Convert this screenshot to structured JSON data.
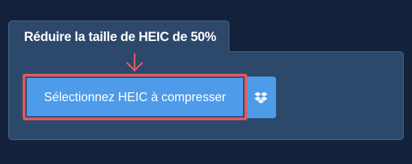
{
  "panel": {
    "title": "Réduire la taille de HEIC de 50%"
  },
  "upload": {
    "button_label": "Sélectionnez HEIC à compresser",
    "dropbox_icon": "dropbox-icon"
  },
  "annotation": {
    "highlight_color": "#e05a5f",
    "arrow_icon": "arrow-down-icon"
  },
  "colors": {
    "background": "#13223a",
    "panel": "#2c496c",
    "button": "#4e9bea"
  }
}
